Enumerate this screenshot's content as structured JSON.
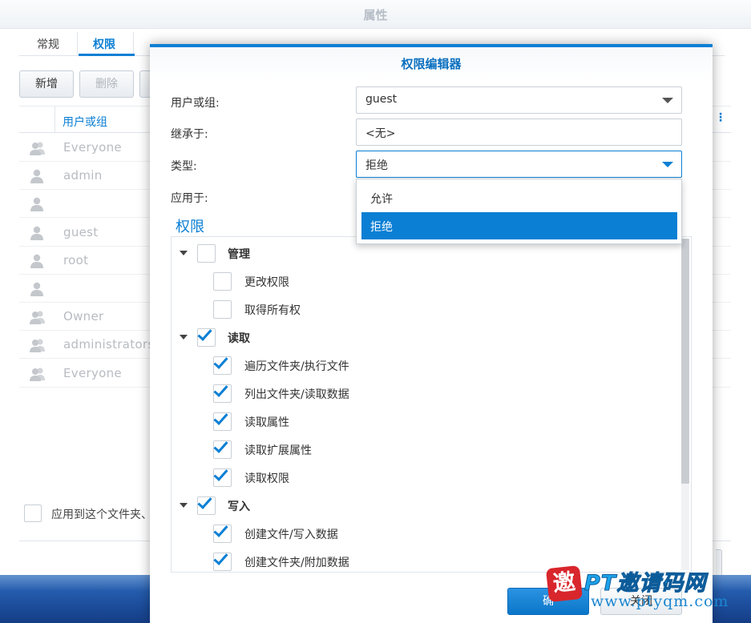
{
  "window": {
    "title": "属性"
  },
  "tabs": [
    {
      "label": "常规"
    },
    {
      "label": "权限"
    }
  ],
  "toolbar": {
    "add_label": "新增",
    "delete_label": "删除"
  },
  "list": {
    "header": "用户或组",
    "rows": [
      {
        "icon": "group-icon",
        "name": "Everyone"
      },
      {
        "icon": "user-icon",
        "name": "admin"
      },
      {
        "icon": "user-icon",
        "name": ""
      },
      {
        "icon": "user-icon",
        "name": "guest"
      },
      {
        "icon": "user-icon",
        "name": "root"
      },
      {
        "icon": "user-icon",
        "name": ""
      },
      {
        "icon": "group-icon",
        "name": "Owner"
      },
      {
        "icon": "group-icon",
        "name": "administrators"
      },
      {
        "icon": "group-icon",
        "name": "Everyone"
      }
    ]
  },
  "apply_to_children_label": "应用到这个文件夹、",
  "dialog": {
    "title": "权限编辑器",
    "user_label": "用户或组:",
    "user_value": "guest",
    "inherit_label": "继承于:",
    "inherit_value": "<无>",
    "type_label": "类型:",
    "type_value": "拒绝",
    "apply_label": "应用于:",
    "type_options": [
      {
        "label": "允许",
        "selected": false
      },
      {
        "label": "拒绝",
        "selected": true
      }
    ],
    "permissions_title": "权限",
    "permissions": [
      {
        "label": "管理",
        "level": 0,
        "checked": false
      },
      {
        "label": "更改权限",
        "level": 1,
        "checked": false
      },
      {
        "label": "取得所有权",
        "level": 1,
        "checked": false
      },
      {
        "label": "读取",
        "level": 0,
        "checked": true
      },
      {
        "label": "遍历文件夹/执行文件",
        "level": 1,
        "checked": true
      },
      {
        "label": "列出文件夹/读取数据",
        "level": 1,
        "checked": true
      },
      {
        "label": "读取属性",
        "level": 1,
        "checked": true
      },
      {
        "label": "读取扩展属性",
        "level": 1,
        "checked": true
      },
      {
        "label": "读取权限",
        "level": 1,
        "checked": true
      },
      {
        "label": "写入",
        "level": 0,
        "checked": true
      },
      {
        "label": "创建文件/写入数据",
        "level": 1,
        "checked": true
      },
      {
        "label": "创建文件夹/附加数据",
        "level": 1,
        "checked": true
      }
    ],
    "ok_label": "确",
    "close_label": "关闭"
  },
  "watermark": {
    "badge": "邀",
    "brand": "PT邀请码网",
    "url": "www.ptyqm.com"
  },
  "colors": {
    "accent": "#0b7fd4",
    "footer": "#1d4f9e"
  }
}
